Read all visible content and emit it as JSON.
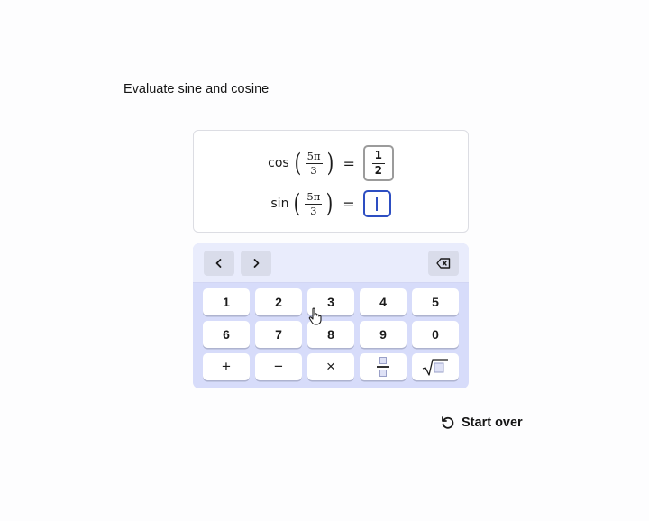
{
  "prompt": {
    "text": "Evaluate sine and cosine"
  },
  "expressions": {
    "cos": {
      "fn": "cos",
      "arg_numerator": "5π",
      "arg_denominator": "3",
      "equals": "=",
      "answer_numerator": "1",
      "answer_denominator": "2"
    },
    "sin": {
      "fn": "sin",
      "arg_numerator": "5π",
      "arg_denominator": "3",
      "equals": "=",
      "input_value": ""
    }
  },
  "keypad": {
    "nav": {
      "left_icon": "chevron-left-icon",
      "right_icon": "chevron-right-icon",
      "backspace_icon": "backspace-icon"
    },
    "keys": [
      {
        "label": "1",
        "name": "key-1"
      },
      {
        "label": "2",
        "name": "key-2"
      },
      {
        "label": "3",
        "name": "key-3"
      },
      {
        "label": "4",
        "name": "key-4"
      },
      {
        "label": "5",
        "name": "key-5"
      },
      {
        "label": "6",
        "name": "key-6"
      },
      {
        "label": "7",
        "name": "key-7"
      },
      {
        "label": "8",
        "name": "key-8"
      },
      {
        "label": "9",
        "name": "key-9"
      },
      {
        "label": "0",
        "name": "key-0"
      },
      {
        "label": "+",
        "name": "key-plus"
      },
      {
        "label": "−",
        "name": "key-minus"
      },
      {
        "label": "×",
        "name": "key-times"
      }
    ],
    "special_keys": {
      "fraction_icon": "fraction-icon",
      "sqrt_icon": "square-root-icon"
    }
  },
  "start_over": {
    "label": "Start over",
    "icon": "restart-icon"
  },
  "colors": {
    "keypad_bg": "#d7dcfa",
    "keypad_top_bg": "#e9ecfc",
    "focus": "#2d4ec2",
    "key_bg": "#ffffff"
  }
}
